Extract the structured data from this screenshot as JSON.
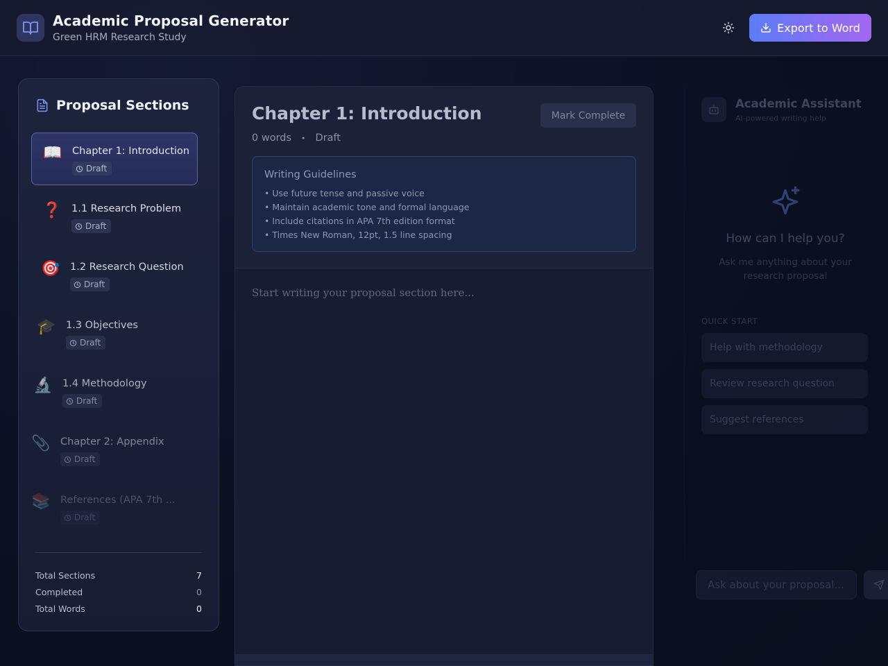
{
  "header": {
    "title": "Academic Proposal Generator",
    "subtitle": "Green HRM Research Study",
    "export_label": "Export to Word"
  },
  "sidebar": {
    "title": "Proposal Sections",
    "items": [
      {
        "emoji": "📖",
        "label": "Chapter 1: Introduction",
        "status": "Draft",
        "active": true
      },
      {
        "emoji": "❓",
        "label": "1.1 Research Problem",
        "status": "Draft"
      },
      {
        "emoji": "🎯",
        "label": "1.2 Research Question",
        "status": "Draft"
      },
      {
        "emoji": "🎓",
        "label": "1.3 Objectives",
        "status": "Draft"
      },
      {
        "emoji": "🔬",
        "label": "1.4 Methodology",
        "status": "Draft"
      },
      {
        "emoji": "📎",
        "label": "Chapter 2: Appendix",
        "status": "Draft"
      },
      {
        "emoji": "📚",
        "label": "References (APA 7th ...",
        "status": "Draft"
      }
    ],
    "stats": [
      {
        "label": "Total Sections",
        "value": "7"
      },
      {
        "label": "Completed",
        "value": "0"
      },
      {
        "label": "Total Words",
        "value": "0"
      }
    ]
  },
  "editor": {
    "title": "Chapter 1: Introduction",
    "mark_complete": "Mark Complete",
    "word_count": "0 words",
    "separator": "•",
    "status": "Draft",
    "guidelines": {
      "title": "Writing Guidelines",
      "items": [
        "• Use future tense and passive voice",
        "• Maintain academic tone and formal language",
        "• Include citations in APA 7th edition format",
        "• Times New Roman, 12pt, 1.5 line spacing"
      ]
    },
    "placeholder": "Start writing your proposal section here..."
  },
  "assistant": {
    "title": "Academic Assistant",
    "subtitle": "AI-powered writing help",
    "help_title": "How can I help you?",
    "help_subtitle": "Ask me anything about your research proposal",
    "quick_start_label": "QUICK START",
    "quick_start": [
      "Help with methodology",
      "Review research question",
      "Suggest references"
    ],
    "input_placeholder": "Ask about your proposal..."
  }
}
